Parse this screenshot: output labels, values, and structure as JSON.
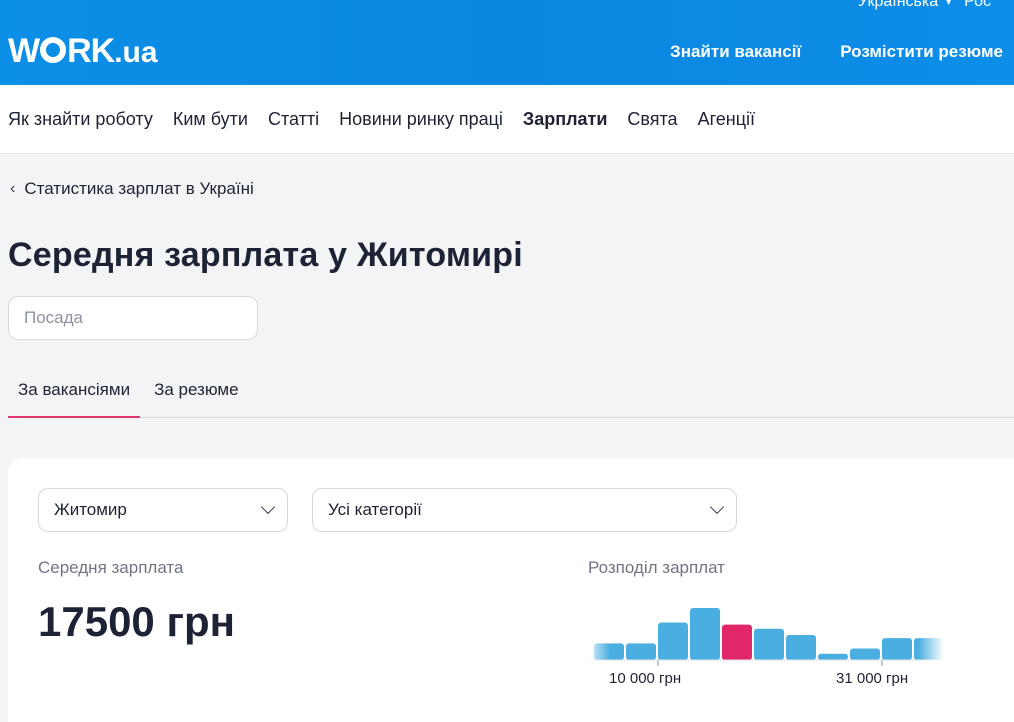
{
  "header": {
    "logo_main": "W",
    "logo_rest": "RK",
    "logo_suffix": ".ua",
    "lang_current": "Українська",
    "lang_other": "Рос",
    "nav": [
      "Знайти вакансії",
      "Розмістити резюме"
    ]
  },
  "subnav": {
    "items": [
      "Як знайти роботу",
      "Ким бути",
      "Статті",
      "Новини ринку праці",
      "Зарплати",
      "Свята",
      "Агенції"
    ],
    "active": "Зарплати"
  },
  "breadcrumb": "Статистика зарплат в Україні",
  "page_title": "Середня зарплата у Житомирі",
  "search": {
    "placeholder": "Посада",
    "value": ""
  },
  "tabs": [
    {
      "label": "За вакансіями",
      "active": true
    },
    {
      "label": "За резюме",
      "active": false
    }
  ],
  "filters": {
    "city": "Житомир",
    "category": "Усі категорії"
  },
  "average": {
    "label": "Середня зарплата",
    "value": "17500 грн"
  },
  "distribution": {
    "label": "Розподіл зарплат",
    "tick_labels": [
      "10 000 грн",
      "31 000 грн"
    ]
  },
  "colors": {
    "header_blue": "#0a86e0",
    "bar_blue": "#4aaee0",
    "bar_highlight": "#e2266a",
    "tab_underline": "#e0356c"
  },
  "chart_data": {
    "type": "bar",
    "bins": 11,
    "relative_heights": [
      0.32,
      0.32,
      0.72,
      1.0,
      0.68,
      0.6,
      0.48,
      0.12,
      0.22,
      0.42,
      0.42
    ],
    "highlight_bin": 4,
    "tick_labels": [
      "10 000 грн",
      "31 000 грн"
    ]
  }
}
